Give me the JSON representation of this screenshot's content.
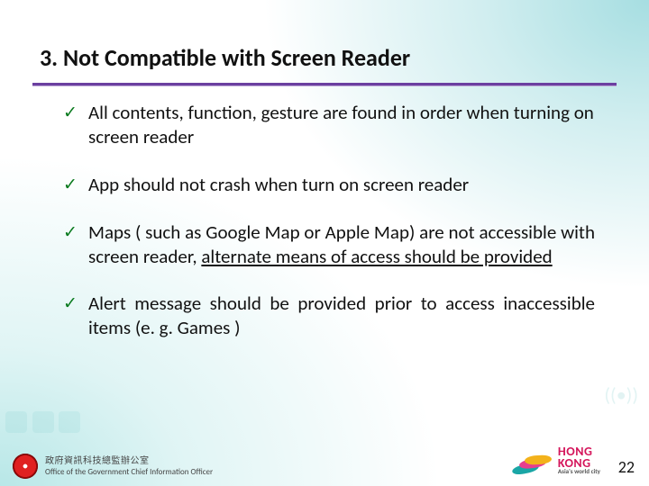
{
  "title": "3. Not Compatible with Screen Reader",
  "bullets": [
    {
      "text": "All contents, function, gesture are found in order when turning on screen reader"
    },
    {
      "text": "App should not crash when turn on screen reader"
    },
    {
      "pre": "Maps ( such as Google Map or Apple Map) are not accessible with screen reader, ",
      "ul": "alternate means of access should be provided"
    },
    {
      "text": "Alert message should be provided prior to access inaccessible items (e. g. Games )"
    }
  ],
  "footer": {
    "orgCn": "政府資訊科技總監辦公室",
    "orgEn": "Office of the Government Chief Information Officer",
    "brandTop": "HONG",
    "brandBot": "KONG",
    "brandTag": "Asia's world city",
    "page": "22"
  }
}
